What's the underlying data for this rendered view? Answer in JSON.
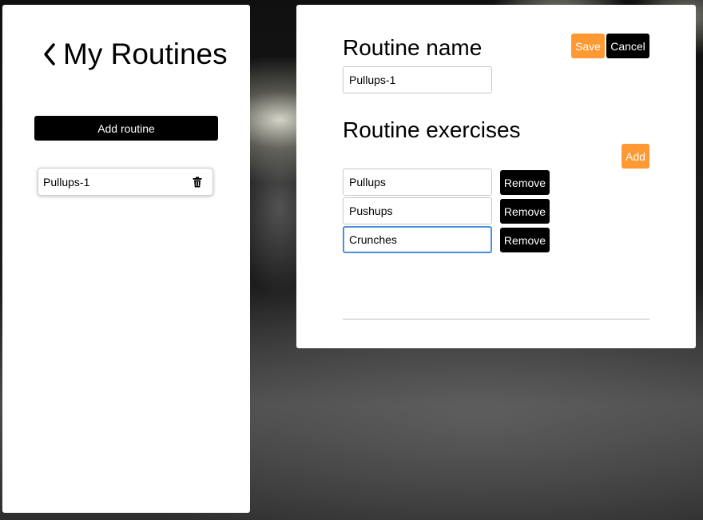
{
  "sidebar": {
    "title": "My Routines",
    "back_icon": "chevron-left-icon",
    "add_routine_label": "Add routine",
    "routines": [
      {
        "label": "Pullups-1",
        "icon": "trash-icon"
      }
    ]
  },
  "editor": {
    "routine_name_heading": "Routine name",
    "routine_name_value": "Pullups-1",
    "save_label": "Save",
    "cancel_label": "Cancel",
    "exercises_heading": "Routine exercises",
    "add_label": "Add",
    "exercises": [
      {
        "value": "Pullups",
        "remove_label": "Remove"
      },
      {
        "value": "Pushups",
        "remove_label": "Remove"
      },
      {
        "value": "Crunches",
        "remove_label": "Remove"
      }
    ]
  },
  "colors": {
    "accent": "#ff9933",
    "dark_button": "#000000",
    "focus_border": "#4a8fdc"
  }
}
